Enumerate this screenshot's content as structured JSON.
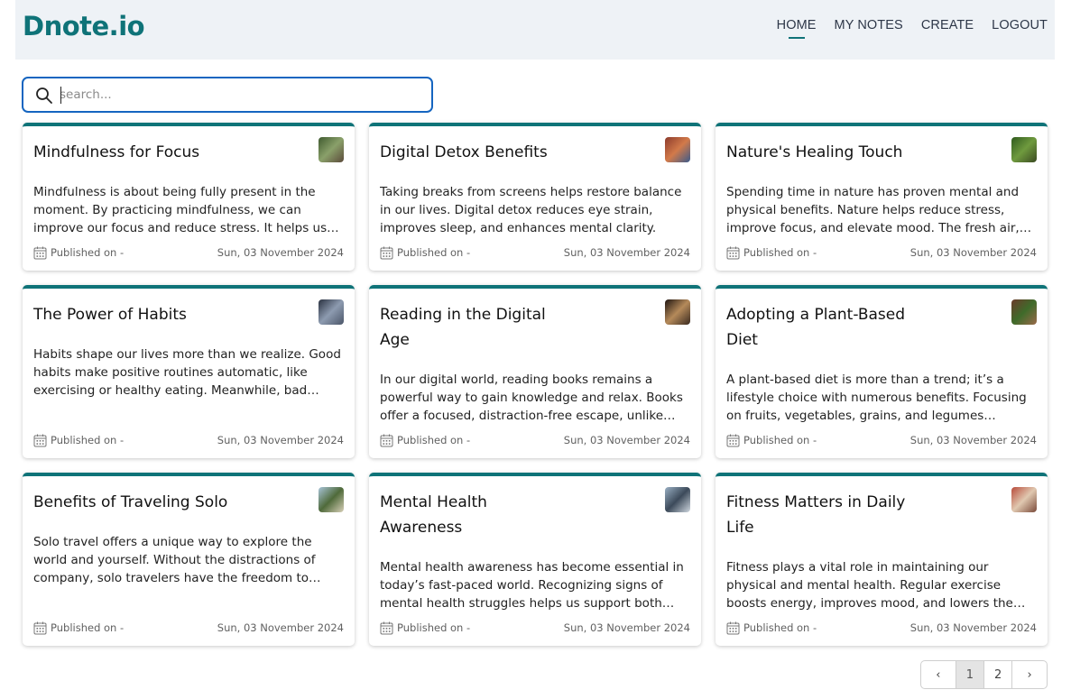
{
  "app": {
    "logo": "Dnote.io"
  },
  "nav": {
    "home": "HOME",
    "my_notes": "MY NOTES",
    "create": "CREATE",
    "logout": "LOGOUT"
  },
  "search": {
    "placeholder": "search...",
    "value": ""
  },
  "cards": [
    {
      "title": "Mindfulness for Focus",
      "body": "Mindfulness is about being fully present in the moment. By practicing mindfulness, we can improve our focus and reduce stress. It helps us stay grounded and attentive.",
      "published_label": "Published on -",
      "date": "Sun, 03 November 2024",
      "thumb_colors": [
        "#3f5a2f",
        "#8aa06a",
        "#5b4a3a"
      ]
    },
    {
      "title": "Digital Detox Benefits",
      "body": "Taking breaks from screens helps restore balance in our lives. Digital detox reduces eye strain, improves sleep, and enhances mental clarity.",
      "published_label": "Published on -",
      "date": "Sun, 03 November 2024",
      "thumb_colors": [
        "#8c3b2c",
        "#d27a4a",
        "#3a5a8c"
      ]
    },
    {
      "title": "Nature's Healing Touch",
      "body": "Spending time in nature has proven mental and physical benefits. Nature helps reduce stress, improve focus, and elevate mood. The fresh air, greenery and calm sounds refresh us.",
      "published_label": "Published on -",
      "date": "Sun, 03 November 2024",
      "thumb_colors": [
        "#2f5a1e",
        "#6f9a3e",
        "#3b4a22"
      ]
    },
    {
      "title": "The Power of Habits",
      "body": "Habits shape our lives more than we realize. Good habits make positive routines automatic, like exercising or healthy eating. Meanwhile, bad habits can hold us back.",
      "published_label": "Published on -",
      "date": "Sun, 03 November 2024",
      "thumb_colors": [
        "#2a3140",
        "#8d9bb0",
        "#4b5568"
      ]
    },
    {
      "title": "Reading in the Digital Age",
      "body": "In our digital world, reading books remains a powerful way to gain knowledge and relax. Books offer a focused, distraction-free escape, unlike endless scrolling.",
      "published_label": "Published on -",
      "date": "Sun, 03 November 2024",
      "thumb_colors": [
        "#1e1410",
        "#b58a5a",
        "#3a2a20"
      ]
    },
    {
      "title": "Adopting a Plant-Based Diet",
      "body": "A plant-based diet is more than a trend; it’s a lifestyle choice with numerous benefits. Focusing on fruits, vegetables, grains, and legumes supports better health.",
      "published_label": "Published on -",
      "date": "Sun, 03 November 2024",
      "thumb_colors": [
        "#6b3a2a",
        "#3f6b2a",
        "#9a6a4a"
      ]
    },
    {
      "title": "Benefits of Traveling Solo",
      "body": "Solo travel offers a unique way to explore the world and yourself. Without the distractions of company, solo travelers have the freedom to follow their own path.",
      "published_label": "Published on -",
      "date": "Sun, 03 November 2024",
      "thumb_colors": [
        "#a8c4d8",
        "#4f6a3a",
        "#d8d0b8"
      ]
    },
    {
      "title": "Mental Health Awareness",
      "body": "Mental health awareness has become essential in today’s fast-paced world. Recognizing signs of mental health struggles helps us support both ourselves and others.",
      "published_label": "Published on -",
      "date": "Sun, 03 November 2024",
      "thumb_colors": [
        "#9ab0c4",
        "#3c4a5a",
        "#d0d8e0"
      ]
    },
    {
      "title": "Fitness Matters in Daily Life",
      "body": "Fitness plays a vital role in maintaining our physical and mental health. Regular exercise boosts energy, improves mood, and lowers the risk of many diseases.",
      "published_label": "Published on -",
      "date": "Sun, 03 November 2024",
      "thumb_colors": [
        "#b84a3a",
        "#e0c8b0",
        "#7a4a3a"
      ]
    }
  ],
  "pagination": {
    "prev": "‹",
    "pages": [
      "1",
      "2"
    ],
    "next": "›",
    "current": "1"
  },
  "colors": {
    "accent": "#0f7378",
    "search_border": "#1565c0",
    "header_bg": "#eef2f6"
  }
}
